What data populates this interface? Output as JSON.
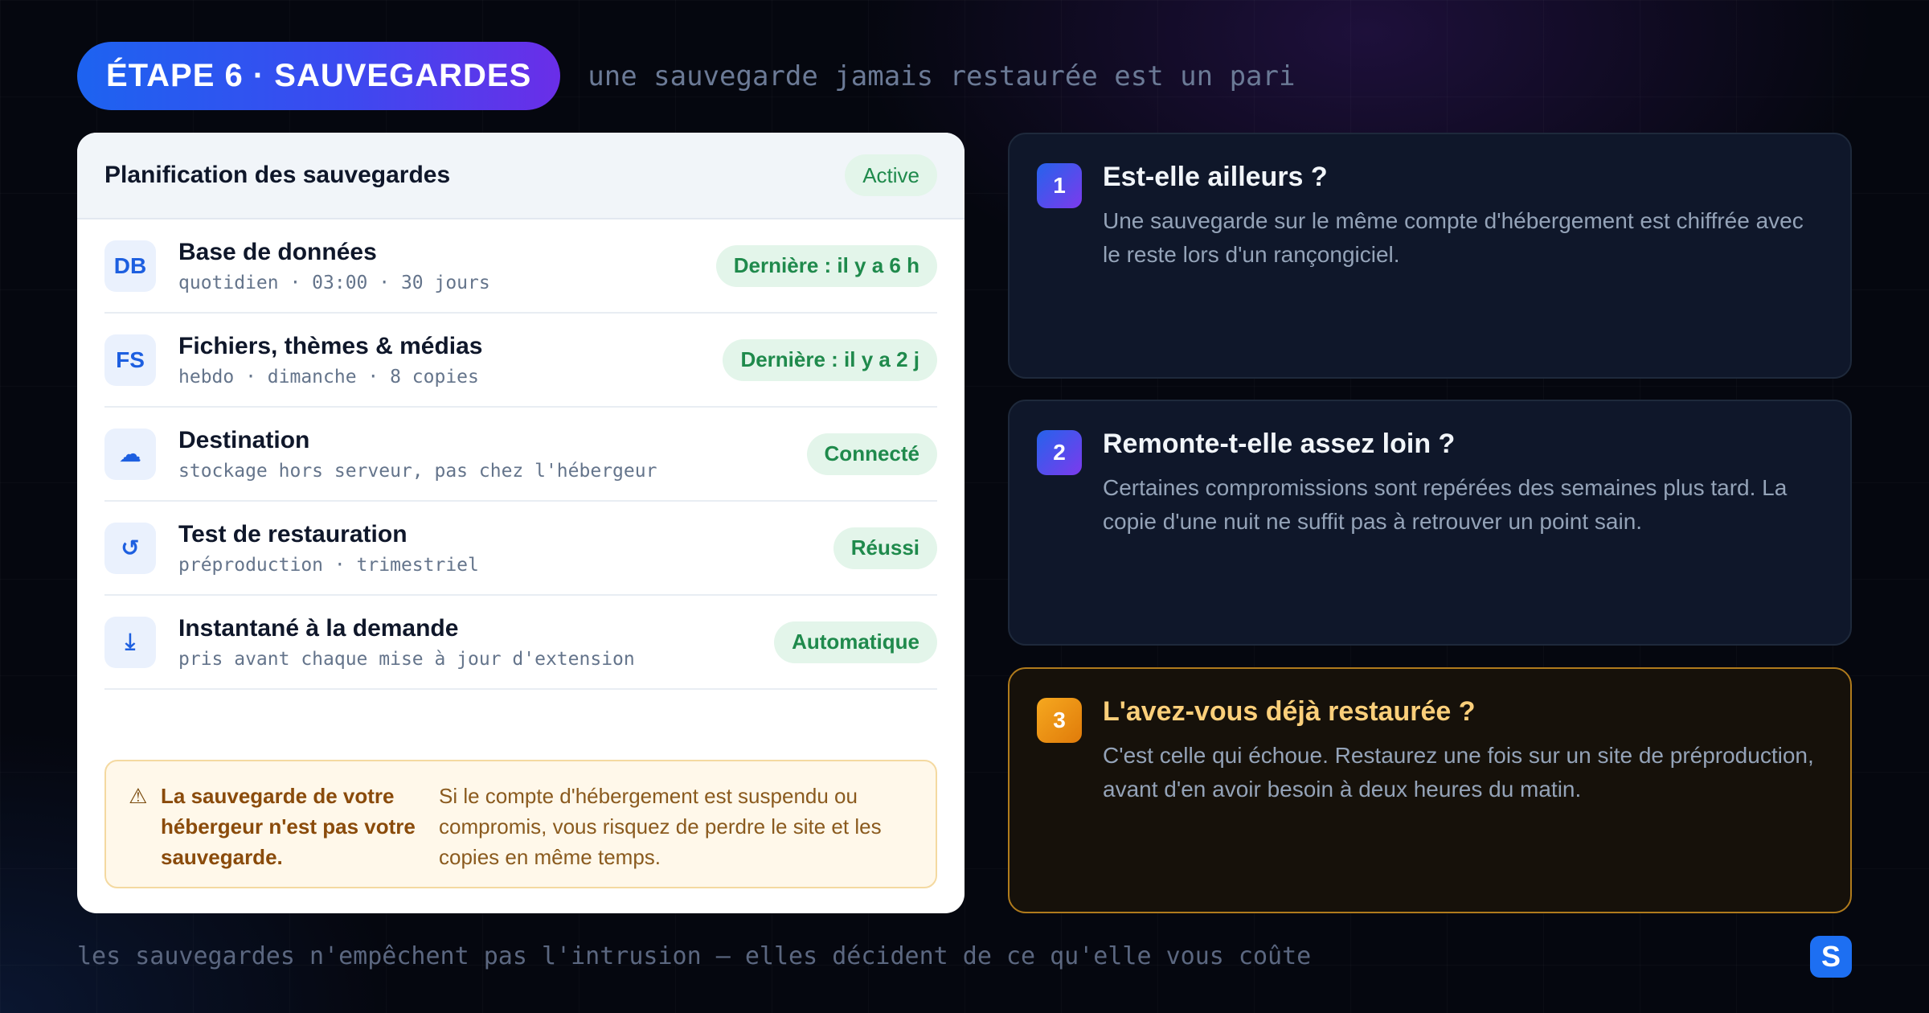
{
  "header": {
    "step_label": "ÉTAPE 6 · SAUVEGARDES",
    "tagline": "une sauvegarde jamais restaurée est un pari"
  },
  "schedule": {
    "title": "Planification des sauvegardes",
    "status": "Active",
    "rows": [
      {
        "icon_text": "DB",
        "icon": "database-icon",
        "title": "Base de données",
        "sub": "quotidien · 03:00 · 30 jours",
        "badge": "Dernière : il y a 6 h"
      },
      {
        "icon_text": "FS",
        "icon": "files-icon",
        "title": "Fichiers, thèmes & médias",
        "sub": "hebdo · dimanche · 8 copies",
        "badge": "Dernière : il y a 2 j"
      },
      {
        "icon_text": "☁",
        "icon": "cloud-icon",
        "title": "Destination",
        "sub": "stockage hors serveur, pas chez l'hébergeur",
        "badge": "Connecté"
      },
      {
        "icon_text": "↺",
        "icon": "restore-icon",
        "title": "Test de restauration",
        "sub": "préproduction · trimestriel",
        "badge": "Réussi"
      },
      {
        "icon_text": "⤓",
        "icon": "download-icon",
        "title": "Instantané à la demande",
        "sub": "pris avant chaque mise à jour d'extension",
        "badge": "Automatique"
      }
    ],
    "warning": {
      "icon": "⚠",
      "bold": "La sauvegarde de votre hébergeur n'est pas votre sauvegarde.",
      "text": "Si le compte d'hébergement est suspendu ou compromis, vous risquez de perdre le site et les copies en même temps."
    }
  },
  "questions": [
    {
      "num": "1",
      "title": "Est-elle ailleurs ?",
      "text": "Une sauvegarde sur le même compte d'hébergement est chiffrée avec le reste lors d'un rançongiciel."
    },
    {
      "num": "2",
      "title": "Remonte-t-elle assez loin ?",
      "text": "Certaines compromissions sont repérées des semaines plus tard. La copie d'une nuit ne suffit pas à retrouver un point sain."
    },
    {
      "num": "3",
      "title": "L'avez-vous déjà restaurée ?",
      "text": "C'est celle qui échoue. Restaurez une fois sur un site de préproduction, avant d'en avoir besoin à deux heures du matin."
    }
  ],
  "footer": {
    "text": "les sauvegardes n'empêchent pas l'intrusion — elles décident de ce qu'elle vous coûte",
    "logo": "S"
  },
  "colors": {
    "accent": "#1d63f0",
    "success": "#1f8a4c",
    "warning": "#8a4b0b",
    "highlight": "#fbcf7a"
  }
}
